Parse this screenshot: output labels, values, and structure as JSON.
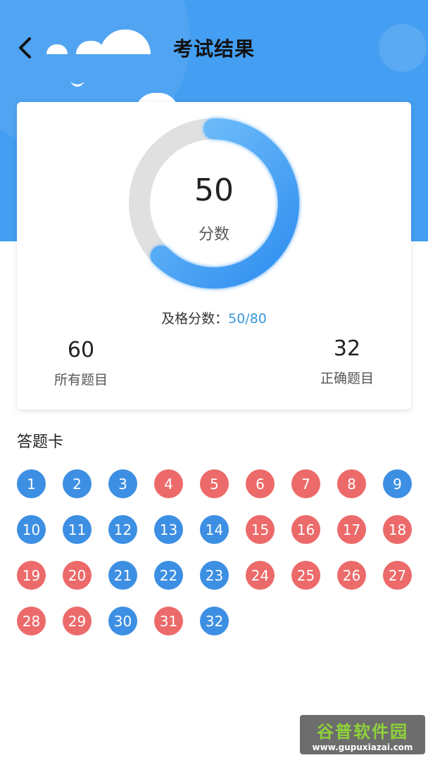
{
  "header": {
    "title": "考试结果"
  },
  "result": {
    "score": "50",
    "score_label": "分数",
    "score_fraction": 0.625,
    "pass_label": "及格分数：",
    "pass_value": "50/80",
    "total_count": "60",
    "total_label": "所有题目",
    "correct_count": "32",
    "correct_label": "正确题目"
  },
  "answer_card": {
    "title": "答题卡",
    "items": [
      {
        "number": "1",
        "status": "correct"
      },
      {
        "number": "2",
        "status": "correct"
      },
      {
        "number": "3",
        "status": "correct"
      },
      {
        "number": "4",
        "status": "wrong"
      },
      {
        "number": "5",
        "status": "wrong"
      },
      {
        "number": "6",
        "status": "wrong"
      },
      {
        "number": "7",
        "status": "wrong"
      },
      {
        "number": "8",
        "status": "wrong"
      },
      {
        "number": "9",
        "status": "correct"
      },
      {
        "number": "10",
        "status": "correct"
      },
      {
        "number": "11",
        "status": "correct"
      },
      {
        "number": "12",
        "status": "correct"
      },
      {
        "number": "13",
        "status": "correct"
      },
      {
        "number": "14",
        "status": "correct"
      },
      {
        "number": "15",
        "status": "wrong"
      },
      {
        "number": "16",
        "status": "wrong"
      },
      {
        "number": "17",
        "status": "wrong"
      },
      {
        "number": "18",
        "status": "wrong"
      },
      {
        "number": "19",
        "status": "wrong"
      },
      {
        "number": "20",
        "status": "wrong"
      },
      {
        "number": "21",
        "status": "correct"
      },
      {
        "number": "22",
        "status": "correct"
      },
      {
        "number": "23",
        "status": "correct"
      },
      {
        "number": "24",
        "status": "wrong"
      },
      {
        "number": "25",
        "status": "wrong"
      },
      {
        "number": "26",
        "status": "wrong"
      },
      {
        "number": "27",
        "status": "wrong"
      },
      {
        "number": "28",
        "status": "wrong"
      },
      {
        "number": "29",
        "status": "wrong"
      },
      {
        "number": "30",
        "status": "correct"
      },
      {
        "number": "31",
        "status": "wrong"
      },
      {
        "number": "32",
        "status": "correct"
      }
    ]
  },
  "colors": {
    "header_bg": "#449ef2",
    "correct": "#3d8fe3",
    "wrong": "#ec6a6a",
    "ring_track": "#e0e0e0",
    "ring_start": "#2f8ef0",
    "ring_end": "#7cc6fb",
    "accent": "#3a97d9"
  },
  "watermark": {
    "brand": "谷普软件园",
    "url": "www.gupuxiazai.com"
  },
  "icons": {
    "back": "chevron-left-icon"
  }
}
